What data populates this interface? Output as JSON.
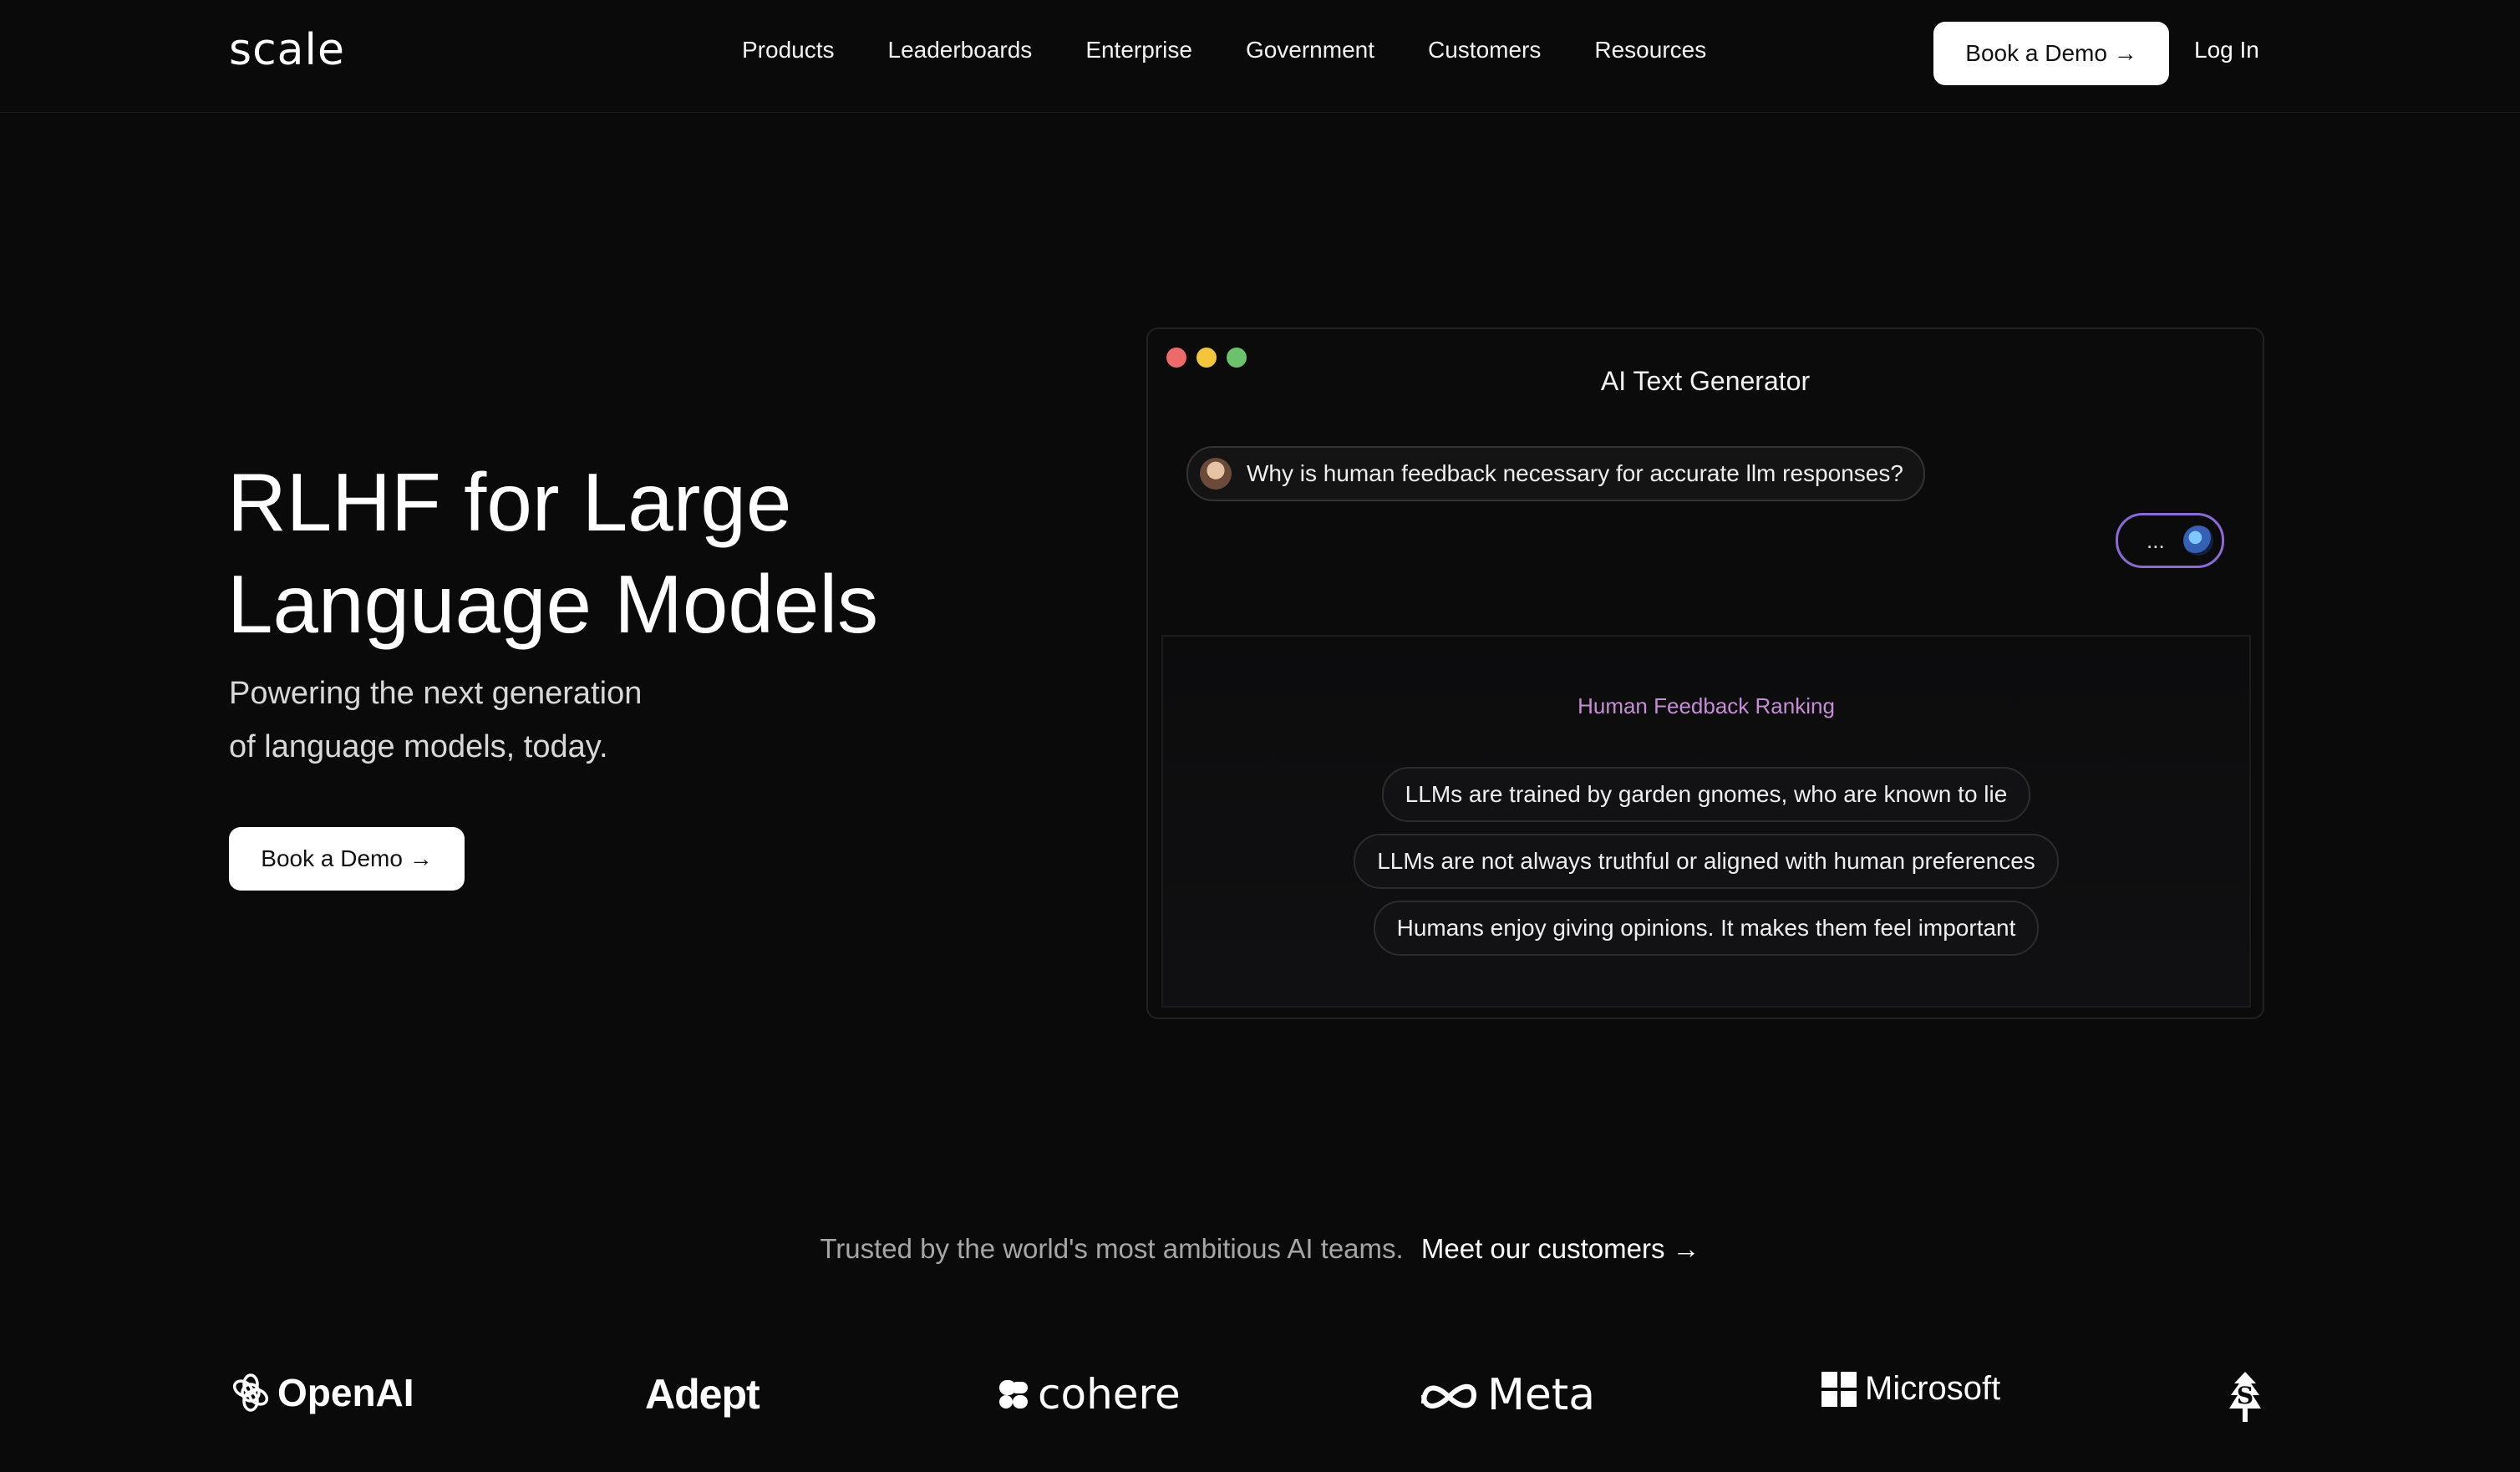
{
  "nav": {
    "logo": "scale",
    "links": [
      "Products",
      "Leaderboards",
      "Enterprise",
      "Government",
      "Customers",
      "Resources"
    ],
    "book_demo": "Book a Demo →",
    "login": "Log In"
  },
  "hero": {
    "title_line1": "RLHF for Large",
    "title_line2": "Language Models",
    "sub_line1": "Powering the next generation",
    "sub_line2": "of language models, today.",
    "button": "Book a Demo →"
  },
  "window": {
    "title": "AI Text Generator",
    "prompt": "Why is human feedback necessary for accurate llm responses?",
    "typing": "...",
    "panel_title": "Human Feedback Ranking",
    "options": [
      "LLMs are trained by garden gnomes, who are known to lie",
      "LLMs are not always truthful or aligned with human preferences",
      "Humans enjoy giving opinions. It makes them feel important"
    ]
  },
  "trust": {
    "text": "Trusted by the world's most ambitious AI teams.",
    "link": "Meet our customers →"
  },
  "customers": {
    "openai": "OpenAI",
    "adept": "Adept",
    "cohere": "cohere",
    "meta": "Meta",
    "microsoft": "Microsoft",
    "stanford": "S"
  },
  "colors": {
    "background": "#0a0a0a",
    "accent_purple": "#c58dd6",
    "dot_red": "#ec6a6a",
    "dot_yellow": "#f3c53b",
    "dot_green": "#6cc26c"
  }
}
